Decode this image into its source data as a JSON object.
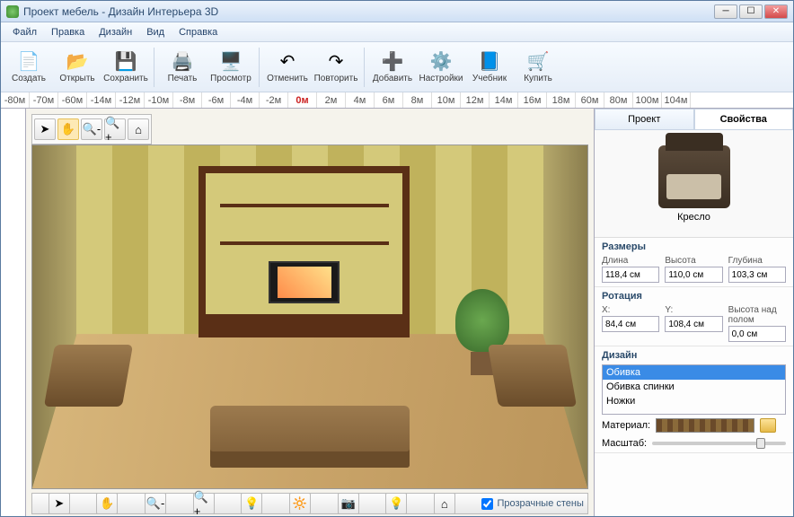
{
  "window": {
    "title": "Проект мебель - Дизайн Интерьера 3D"
  },
  "menu": {
    "file": "Файл",
    "edit": "Правка",
    "design": "Дизайн",
    "view": "Вид",
    "help": "Справка"
  },
  "toolbar": {
    "create": "Создать",
    "open": "Открыть",
    "save": "Сохранить",
    "print": "Печать",
    "view": "Просмотр",
    "undo": "Отменить",
    "redo": "Повторить",
    "add": "Добавить",
    "settings": "Настройки",
    "tutorial": "Учебник",
    "buy": "Купить"
  },
  "ruler": [
    "-80м",
    "-70м",
    "-60м",
    "-14м",
    "-12м",
    "-10м",
    "-8м",
    "-6м",
    "-4м",
    "-2м",
    "0м",
    "2м",
    "4м",
    "6м",
    "8м",
    "10м",
    "12м",
    "14м",
    "16м",
    "18м",
    "60м",
    "80м",
    "100м",
    "104м"
  ],
  "bottom": {
    "transparent_walls": "Прозрачные стены"
  },
  "panel": {
    "tab_project": "Проект",
    "tab_properties": "Свойства",
    "preview_label": "Кресло",
    "dimensions": {
      "title": "Размеры",
      "length_label": "Длина",
      "length": "118,4 см",
      "height_label": "Высота",
      "height": "110,0 см",
      "depth_label": "Глубина",
      "depth": "103,3 см"
    },
    "rotation": {
      "title": "Ротация",
      "x_label": "X:",
      "x": "84,4 см",
      "y_label": "Y:",
      "y": "108,4 см",
      "z_label": "Высота над полом",
      "z": "0,0 см"
    },
    "design": {
      "title": "Дизайн",
      "items": [
        "Обивка",
        "Обивка спинки",
        "Ножки"
      ]
    },
    "material_label": "Материал:",
    "scale_label": "Масштаб:"
  }
}
